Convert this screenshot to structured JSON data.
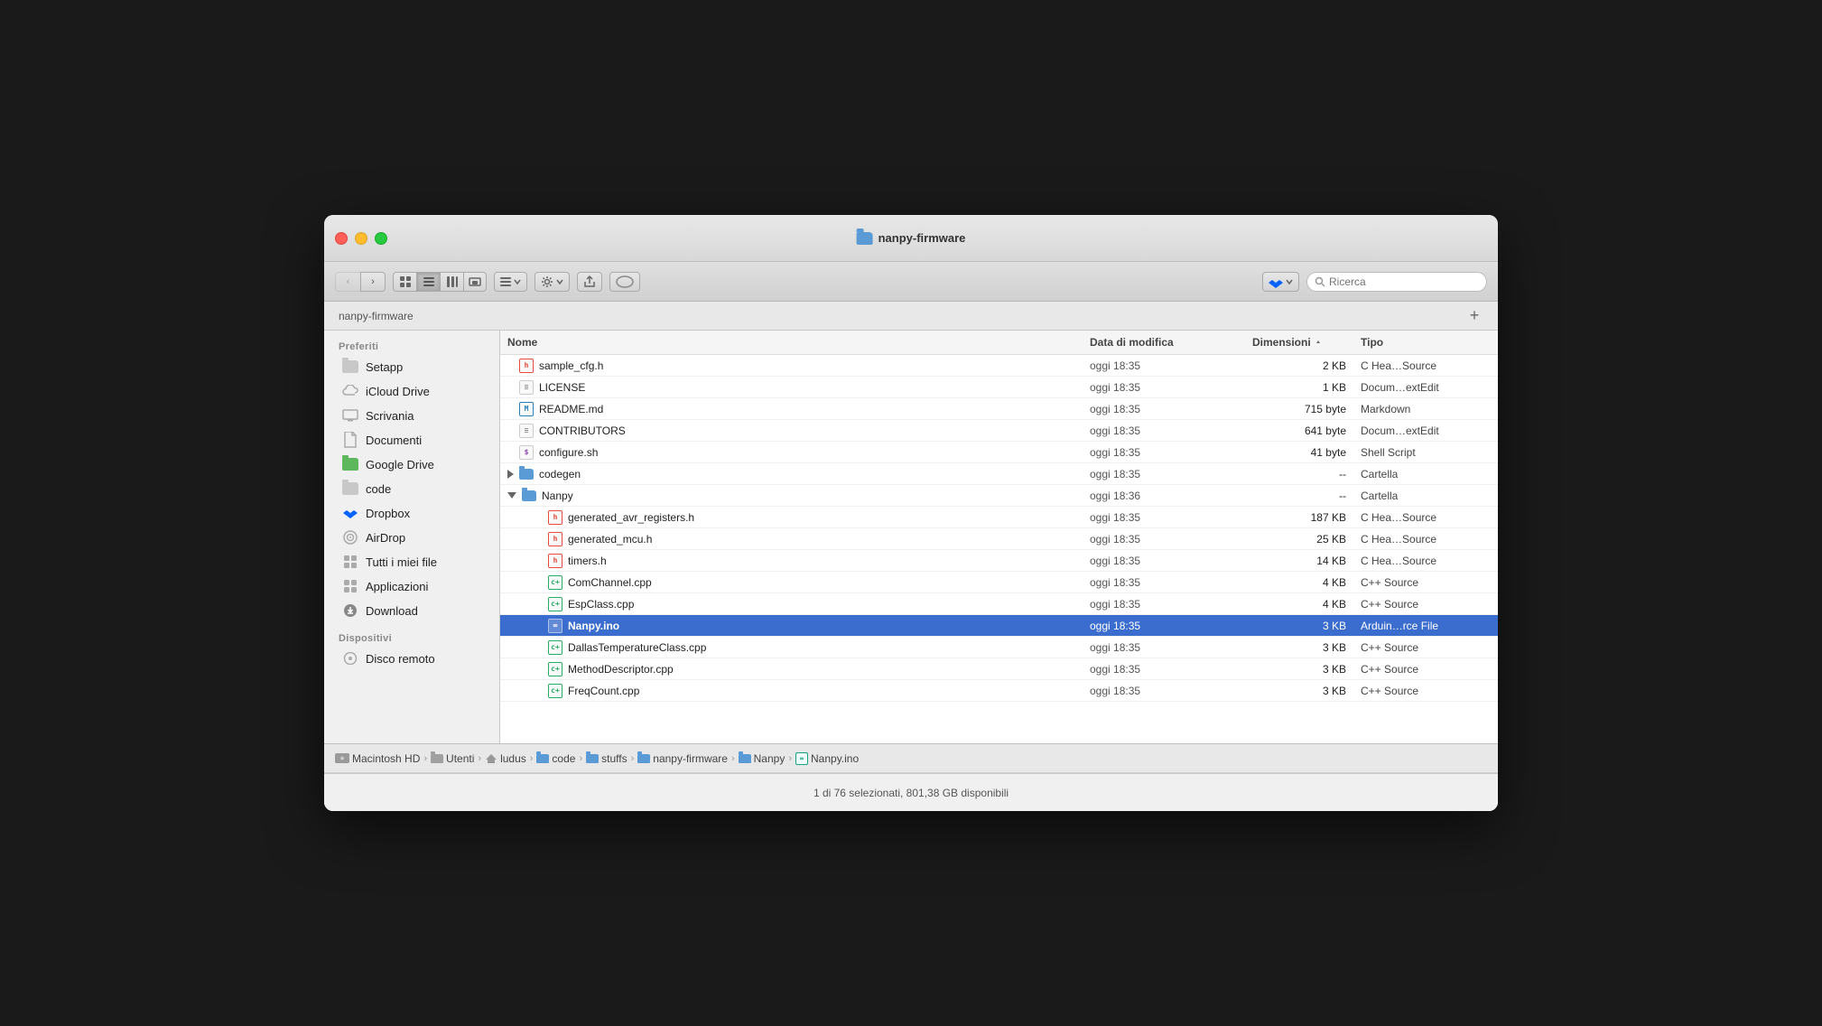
{
  "window": {
    "title": "nanpy-firmware",
    "traffic_lights": {
      "close_label": "",
      "minimize_label": "",
      "maximize_label": ""
    }
  },
  "toolbar": {
    "back_label": "‹",
    "forward_label": "›",
    "view_icon_label": "⊞",
    "view_list_label": "≡",
    "view_column_label": "⊟",
    "view_cover_label": "⊠",
    "view_group_label": "⊞",
    "action_label": "⚙",
    "share_label": "↑",
    "tag_label": "○",
    "dropbox_label": "✦",
    "search_placeholder": "Ricerca"
  },
  "breadcrumb_bar": {
    "title": "nanpy-firmware",
    "add_btn": "+"
  },
  "sidebar": {
    "favorites_label": "Preferiti",
    "items": [
      {
        "id": "setapp",
        "label": "Setapp",
        "icon": "folder"
      },
      {
        "id": "icloud",
        "label": "iCloud Drive",
        "icon": "cloud"
      },
      {
        "id": "scrivania",
        "label": "Scrivania",
        "icon": "desktop"
      },
      {
        "id": "documenti",
        "label": "Documenti",
        "icon": "folder"
      },
      {
        "id": "google-drive",
        "label": "Google Drive",
        "icon": "folder-green"
      },
      {
        "id": "code",
        "label": "code",
        "icon": "folder"
      },
      {
        "id": "dropbox",
        "label": "Dropbox",
        "icon": "dropbox"
      },
      {
        "id": "airdrop",
        "label": "AirDrop",
        "icon": "airdrop"
      },
      {
        "id": "tutti-file",
        "label": "Tutti i miei file",
        "icon": "grid"
      },
      {
        "id": "applicazioni",
        "label": "Applicazioni",
        "icon": "apps"
      },
      {
        "id": "download",
        "label": "Download",
        "icon": "download"
      }
    ],
    "devices_label": "Dispositivi",
    "devices": [
      {
        "id": "disco-remoto",
        "label": "Disco remoto",
        "icon": "disk"
      }
    ]
  },
  "columns": {
    "name": "Nome",
    "modified": "Data di modifica",
    "size": "Dimensioni",
    "type": "Tipo"
  },
  "files": [
    {
      "indent": 1,
      "icon": "h",
      "name": "sample_cfg.h",
      "modified": "oggi 18:35",
      "size": "2 KB",
      "type": "C Hea…Source",
      "selected": false,
      "expandable": false
    },
    {
      "indent": 1,
      "icon": "doc",
      "name": "LICENSE",
      "modified": "oggi 18:35",
      "size": "1 KB",
      "type": "Docum…extEdit",
      "selected": false,
      "expandable": false
    },
    {
      "indent": 1,
      "icon": "md",
      "name": "README.md",
      "modified": "oggi 18:35",
      "size": "715 byte",
      "type": "Markdown",
      "selected": false,
      "expandable": false
    },
    {
      "indent": 1,
      "icon": "doc",
      "name": "CONTRIBUTORS",
      "modified": "oggi 18:35",
      "size": "641 byte",
      "type": "Docum…extEdit",
      "selected": false,
      "expandable": false
    },
    {
      "indent": 1,
      "icon": "sh",
      "name": "configure.sh",
      "modified": "oggi 18:35",
      "size": "41 byte",
      "type": "Shell Script",
      "selected": false,
      "expandable": false
    },
    {
      "indent": 1,
      "icon": "folder",
      "name": "codegen",
      "modified": "oggi 18:35",
      "size": "--",
      "type": "Cartella",
      "selected": false,
      "expandable": true,
      "expanded": false
    },
    {
      "indent": 1,
      "icon": "folder",
      "name": "Nanpy",
      "modified": "oggi 18:36",
      "size": "--",
      "type": "Cartella",
      "selected": false,
      "expandable": true,
      "expanded": true
    },
    {
      "indent": 2,
      "icon": "h",
      "name": "generated_avr_registers.h",
      "modified": "oggi 18:35",
      "size": "187 KB",
      "type": "C Hea…Source",
      "selected": false,
      "expandable": false
    },
    {
      "indent": 2,
      "icon": "h",
      "name": "generated_mcu.h",
      "modified": "oggi 18:35",
      "size": "25 KB",
      "type": "C Hea…Source",
      "selected": false,
      "expandable": false
    },
    {
      "indent": 2,
      "icon": "h",
      "name": "timers.h",
      "modified": "oggi 18:35",
      "size": "14 KB",
      "type": "C Hea…Source",
      "selected": false,
      "expandable": false
    },
    {
      "indent": 2,
      "icon": "cpp",
      "name": "ComChannel.cpp",
      "modified": "oggi 18:35",
      "size": "4 KB",
      "type": "C++ Source",
      "selected": false,
      "expandable": false
    },
    {
      "indent": 2,
      "icon": "cpp",
      "name": "EspClass.cpp",
      "modified": "oggi 18:35",
      "size": "4 KB",
      "type": "C++ Source",
      "selected": false,
      "expandable": false
    },
    {
      "indent": 2,
      "icon": "ino",
      "name": "Nanpy.ino",
      "modified": "oggi 18:35",
      "size": "3 KB",
      "type": "Arduin…rce File",
      "selected": true,
      "expandable": false
    },
    {
      "indent": 2,
      "icon": "cpp",
      "name": "DallasTemperatureClass.cpp",
      "modified": "oggi 18:35",
      "size": "3 KB",
      "type": "C++ Source",
      "selected": false,
      "expandable": false
    },
    {
      "indent": 2,
      "icon": "cpp",
      "name": "MethodDescriptor.cpp",
      "modified": "oggi 18:35",
      "size": "3 KB",
      "type": "C++ Source",
      "selected": false,
      "expandable": false
    },
    {
      "indent": 2,
      "icon": "cpp",
      "name": "FreqCount.cpp",
      "modified": "oggi 18:35",
      "size": "3 KB",
      "type": "C++ Source",
      "selected": false,
      "expandable": false
    }
  ],
  "path_bar": {
    "items": [
      {
        "label": "Macintosh HD",
        "icon": "hd"
      },
      {
        "label": "Utenti",
        "icon": "folder"
      },
      {
        "label": "ludus",
        "icon": "home"
      },
      {
        "label": "code",
        "icon": "folder-blue"
      },
      {
        "label": "stuffs",
        "icon": "folder-blue"
      },
      {
        "label": "nanpy-firmware",
        "icon": "folder-blue"
      },
      {
        "label": "Nanpy",
        "icon": "folder-blue"
      },
      {
        "label": "Nanpy.ino",
        "icon": "ino"
      }
    ]
  },
  "status": {
    "text": "1 di 76 selezionati, 801,38 GB disponibili"
  }
}
